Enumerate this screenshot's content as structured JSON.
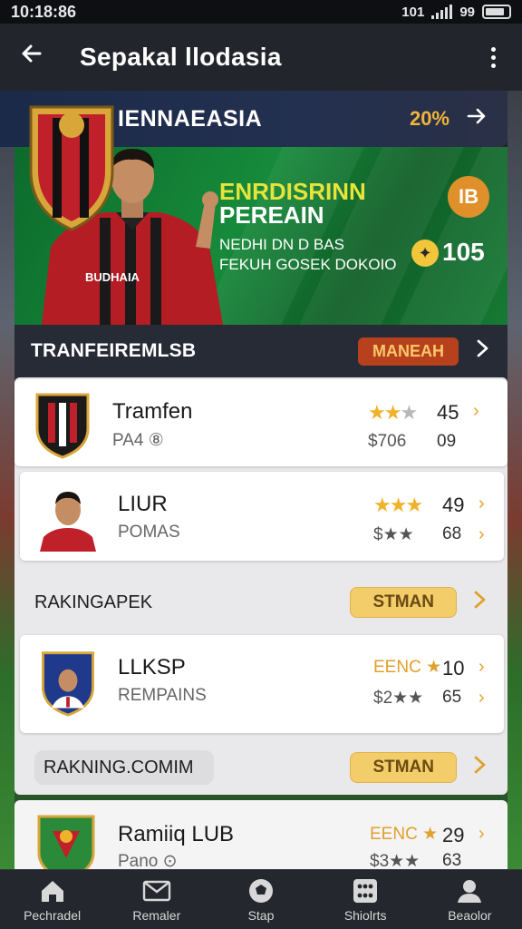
{
  "status_bar": {
    "time": "10:18:86",
    "network": "101",
    "battery": "99"
  },
  "app_bar": {
    "back_icon": "arrow-left-icon",
    "title": "Sepakal llodasia",
    "menu_icon": "more-vertical-icon"
  },
  "league_strip": {
    "name": "IENNAEASIA",
    "percent": "20%"
  },
  "hero": {
    "headline1": "ENRDISRINN",
    "headline2": "PEREAIN",
    "sub1": "NEDHI DN D BAS",
    "sub2": "FEKUH GOSEK DOKOIO",
    "badge": "IB",
    "coins": "105"
  },
  "transfer_section": {
    "label": "TRANFEIREMLSB",
    "button": "MANEAH"
  },
  "cards": [
    {
      "title": "Tramfen",
      "subtitle": "PA4 ⑧",
      "stars": "★★",
      "stars_grey": "★",
      "price": "$706",
      "n1": "45",
      "n2": "09"
    },
    {
      "title": "LIUR",
      "subtitle": "POMAS",
      "stars": "★★★",
      "price2_stars": "$★★",
      "n1": "49",
      "n2": "68"
    }
  ],
  "ranking1": {
    "label": "RAKINGAPEK",
    "button": "STMAN"
  },
  "card3": {
    "title": "LLKSP",
    "subtitle": "REMPAINS",
    "stars_label": "EENC ★",
    "price2_stars": "$2★★",
    "n1": "10",
    "n2": "65"
  },
  "ranking2": {
    "label": "RAKNING.COMIM",
    "button": "STMAN"
  },
  "card4": {
    "title": "Ramiiq LUB",
    "subtitle": "Pano ⊙",
    "stars_label": "EENC ★",
    "price2_stars": "$3★★",
    "n1": "29",
    "n2": "63"
  },
  "bottom_nav": [
    {
      "label": "Pechradel",
      "icon": "home-icon"
    },
    {
      "label": "Remaler",
      "icon": "mail-icon"
    },
    {
      "label": "Stap",
      "icon": "ball-icon"
    },
    {
      "label": "Shiolrts",
      "icon": "grid-icon"
    },
    {
      "label": "Beaolor",
      "icon": "profile-icon"
    }
  ],
  "colors": {
    "accent_orange": "#e0902a",
    "gold": "#f0b22a",
    "green": "#168a3a",
    "button_red": "#b6411c",
    "button_gold": "#f3cd6a"
  }
}
